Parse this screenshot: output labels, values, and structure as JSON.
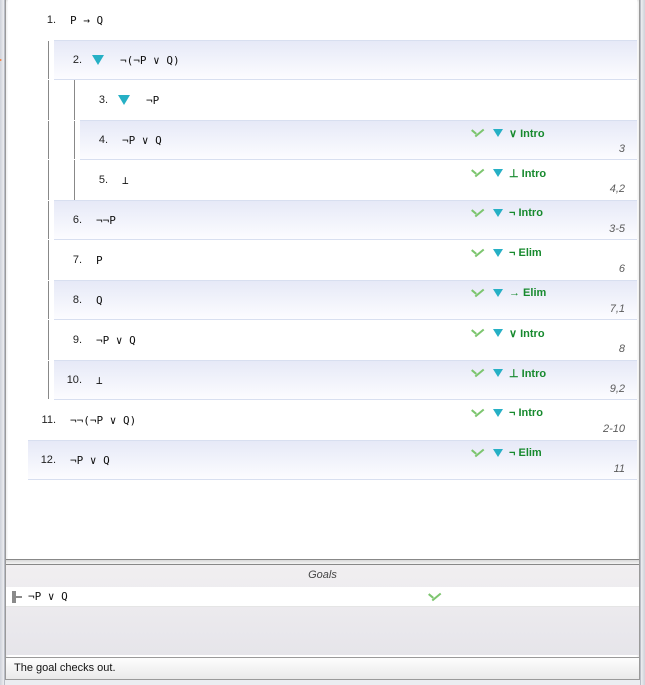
{
  "current_line_marker": 2,
  "lines": [
    {
      "n": 1,
      "depth": 0,
      "formula": "P → Q",
      "toggle": false,
      "rule": null,
      "refs": null,
      "alt": false
    },
    {
      "n": 2,
      "depth": 1,
      "formula": "¬(¬P ∨ Q)",
      "toggle": true,
      "rule": null,
      "refs": null,
      "alt": true
    },
    {
      "n": 3,
      "depth": 2,
      "formula": "¬P",
      "toggle": true,
      "rule": null,
      "refs": null,
      "alt": false
    },
    {
      "n": 4,
      "depth": 2,
      "formula": "¬P ∨ Q",
      "toggle": false,
      "rule": "∨ Intro",
      "refs": "3",
      "alt": true
    },
    {
      "n": 5,
      "depth": 2,
      "formula": "⊥",
      "toggle": false,
      "rule": "⊥ Intro",
      "refs": "4,2",
      "alt": false
    },
    {
      "n": 6,
      "depth": 1,
      "formula": "¬¬P",
      "toggle": false,
      "rule": "¬ Intro",
      "refs": "3-5",
      "alt": true
    },
    {
      "n": 7,
      "depth": 1,
      "formula": "P",
      "toggle": false,
      "rule": "¬ Elim",
      "refs": "6",
      "alt": false
    },
    {
      "n": 8,
      "depth": 1,
      "formula": "Q",
      "toggle": false,
      "rule": "→ Elim",
      "refs": "7,1",
      "alt": true
    },
    {
      "n": 9,
      "depth": 1,
      "formula": "¬P ∨ Q",
      "toggle": false,
      "rule": "∨ Intro",
      "refs": "8",
      "alt": false
    },
    {
      "n": 10,
      "depth": 1,
      "formula": "⊥",
      "toggle": false,
      "rule": "⊥ Intro",
      "refs": "9,2",
      "alt": true
    },
    {
      "n": 11,
      "depth": 0,
      "formula": "¬¬(¬P ∨ Q)",
      "toggle": false,
      "rule": "¬ Intro",
      "refs": "2-10",
      "alt": false
    },
    {
      "n": 12,
      "depth": 0,
      "formula": "¬P ∨ Q",
      "toggle": false,
      "rule": "¬ Elim",
      "refs": "11",
      "alt": true
    }
  ],
  "goals_title": "Goals",
  "goal": {
    "formula": "¬P ∨ Q",
    "satisfied": true
  },
  "status": "The goal checks out."
}
